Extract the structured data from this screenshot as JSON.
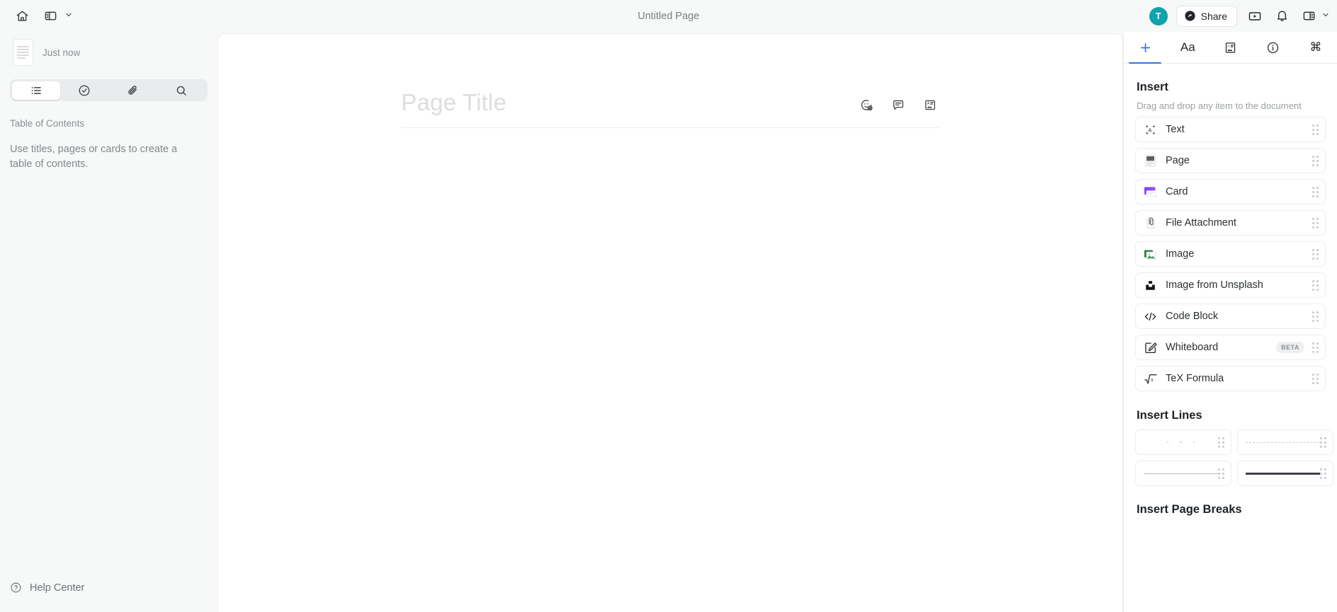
{
  "window": {
    "title": "Untitled Page"
  },
  "topbar": {
    "home_icon": "home-icon",
    "sidebar_toggle_icon": "left-panel-icon",
    "chevron_icon": "chevron-down-icon",
    "avatar_initial": "T",
    "share_label": "Share",
    "share_icon": "share-circle-icon",
    "present_icon": "present-play-icon",
    "bell_icon": "bell-icon",
    "right_panel_icon": "right-panel-icon",
    "right_chevron_icon": "chevron-down-icon"
  },
  "sidebar": {
    "doc_time": "Just now",
    "tabs": [
      {
        "name": "outline",
        "icon": "list-icon",
        "active": true
      },
      {
        "name": "tasks",
        "icon": "check-circle-icon",
        "active": false
      },
      {
        "name": "attachments",
        "icon": "paperclip-icon",
        "active": false
      },
      {
        "name": "search",
        "icon": "search-icon",
        "active": false
      }
    ],
    "toc_label": "Table of Contents",
    "toc_empty": "Use titles, pages or cards to create a table of contents.",
    "help_label": "Help Center",
    "help_icon": "question-circle-icon"
  },
  "document": {
    "title_placeholder": "Page Title",
    "actions": [
      {
        "name": "add-reaction",
        "icon": "emoji-plus-icon"
      },
      {
        "name": "comment",
        "icon": "comment-icon"
      },
      {
        "name": "cover",
        "icon": "cover-image-icon"
      }
    ]
  },
  "right_panel": {
    "tabs": [
      {
        "name": "insert",
        "icon": "plus-icon",
        "active": true
      },
      {
        "name": "text-styles",
        "icon": "aa-icon",
        "label": "Aa",
        "active": false
      },
      {
        "name": "templates",
        "icon": "card-template-icon",
        "active": false
      },
      {
        "name": "info",
        "icon": "info-circle-icon",
        "active": false
      },
      {
        "name": "shortcuts",
        "icon": "command-icon",
        "label": "⌘",
        "active": false
      }
    ],
    "insert": {
      "heading": "Insert",
      "subtitle": "Drag and drop any item to the document",
      "items": [
        {
          "label": "Text",
          "icon": "text-box-icon",
          "badge": ""
        },
        {
          "label": "Page",
          "icon": "page-icon",
          "badge": ""
        },
        {
          "label": "Card",
          "icon": "card-icon",
          "badge": ""
        },
        {
          "label": "File Attachment",
          "icon": "file-attachment-icon",
          "badge": ""
        },
        {
          "label": "Image",
          "icon": "image-icon",
          "badge": ""
        },
        {
          "label": "Image from Unsplash",
          "icon": "unsplash-icon",
          "badge": ""
        },
        {
          "label": "Code Block",
          "icon": "code-icon",
          "badge": ""
        },
        {
          "label": "Whiteboard",
          "icon": "whiteboard-icon",
          "badge": "BETA"
        },
        {
          "label": "TeX Formula",
          "icon": "sqrt-icon",
          "badge": ""
        }
      ]
    },
    "lines": {
      "heading": "Insert Lines",
      "items": [
        {
          "name": "dotted-line",
          "style": "dots"
        },
        {
          "name": "dashed-line",
          "style": "dashed"
        },
        {
          "name": "thin-line",
          "style": "thin"
        },
        {
          "name": "thick-line",
          "style": "thick"
        }
      ]
    },
    "page_breaks": {
      "heading": "Insert Page Breaks"
    }
  }
}
